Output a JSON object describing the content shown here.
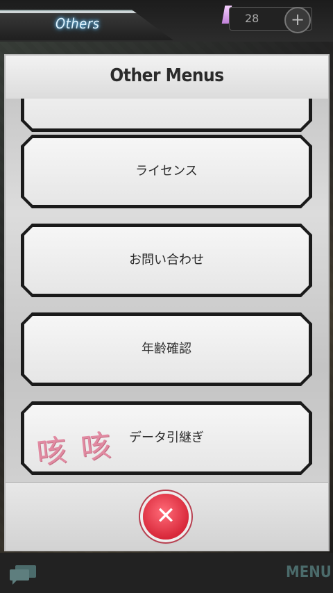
{
  "header": {
    "tab_title": "Others",
    "currency_value": "28",
    "plus_icon": "plus-icon"
  },
  "modal": {
    "title": "Other Menus",
    "items": [
      {
        "label": ""
      },
      {
        "label": "ライセンス"
      },
      {
        "label": "お問い合わせ"
      },
      {
        "label": "年齢確認"
      },
      {
        "label": "データ引継ぎ"
      }
    ],
    "close_icon": "close-icon",
    "close_symbol": "✕"
  },
  "watermark": "咳咳",
  "footer": {
    "chat_icon": "chat-icon",
    "menu_label": "MENU"
  },
  "colors": {
    "close_button": "#d8283a",
    "title_glow": "#7fd6ff"
  }
}
